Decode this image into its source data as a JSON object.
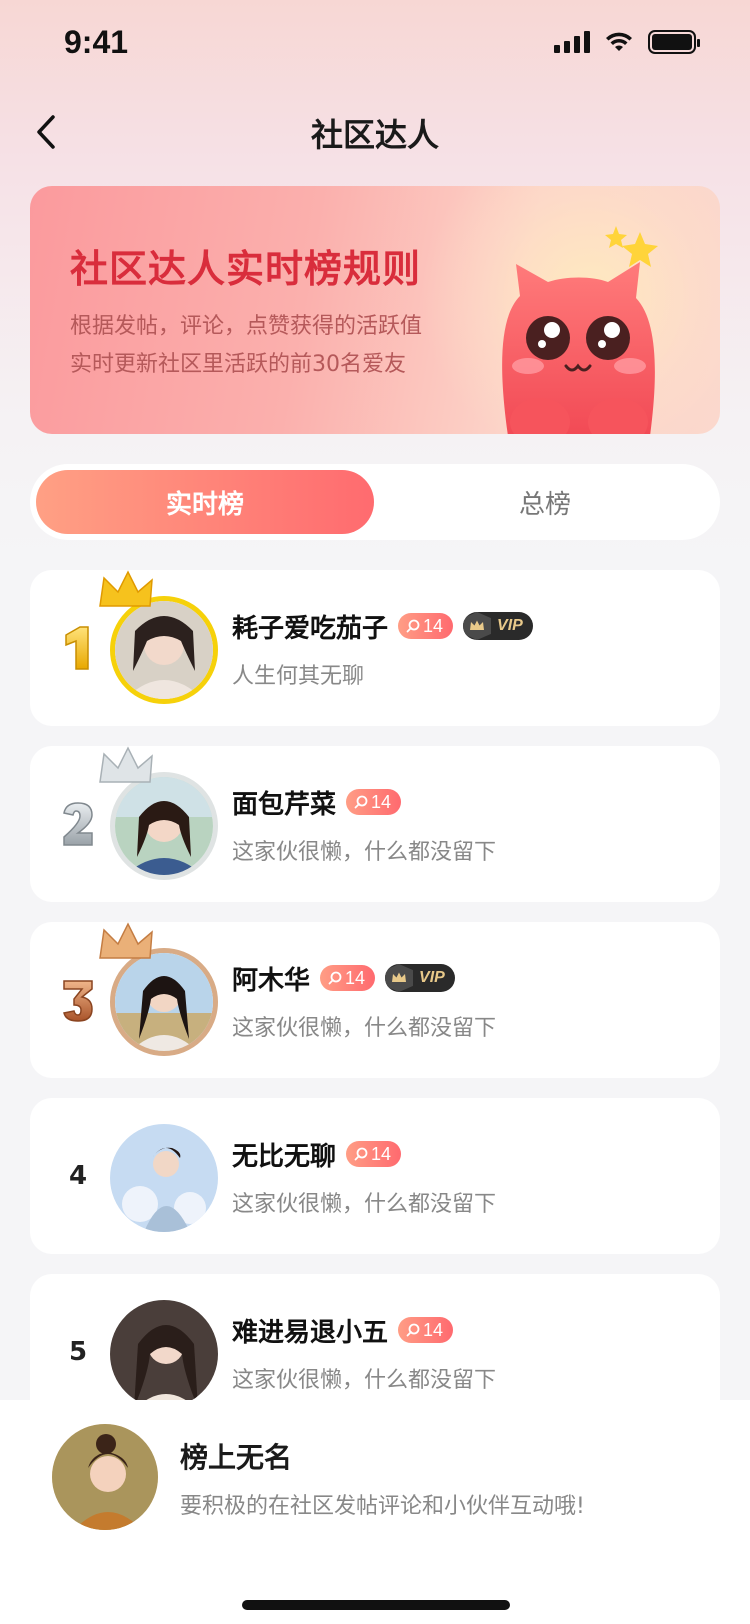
{
  "status": {
    "time": "9:41"
  },
  "nav": {
    "title": "社区达人",
    "back_icon": "chevron-left-icon"
  },
  "banner": {
    "title": "社区达人实时榜规则",
    "desc_line1": "根据发帖，评论，点赞获得的活跃值",
    "desc_line2": "实时更新社区里活跃的前30名爱友"
  },
  "tabs": [
    {
      "label": "实时榜",
      "active": true
    },
    {
      "label": "总榜",
      "active": false
    }
  ],
  "ranking": [
    {
      "rank": "1",
      "name": "耗子爱吃茄子",
      "level": "14",
      "vip": true,
      "bio": "人生何其无聊",
      "medal": "gold"
    },
    {
      "rank": "2",
      "name": "面包芹菜",
      "level": "14",
      "vip": false,
      "bio": "这家伙很懒，什么都没留下",
      "medal": "silver"
    },
    {
      "rank": "3",
      "name": "阿木华",
      "level": "14",
      "vip": true,
      "bio": "这家伙很懒，什么都没留下",
      "medal": "bronze"
    },
    {
      "rank": "4",
      "name": "无比无聊",
      "level": "14",
      "vip": false,
      "bio": "这家伙很懒，什么都没留下",
      "medal": "none"
    },
    {
      "rank": "5",
      "name": "难进易退小五",
      "level": "14",
      "vip": false,
      "bio": "这家伙很懒，什么都没留下",
      "medal": "none"
    }
  ],
  "vip_label": "VIP",
  "self": {
    "name": "榜上无名",
    "tip": "要积极的在社区发帖评论和小伙伴互动哦!"
  },
  "colors": {
    "accent_start": "#ffa084",
    "accent_end": "#ff6b6f",
    "banner_title": "#d92d3c",
    "gold": "#f6d10a",
    "silver": "#dfe3e3",
    "bronze": "#d8ab86"
  }
}
